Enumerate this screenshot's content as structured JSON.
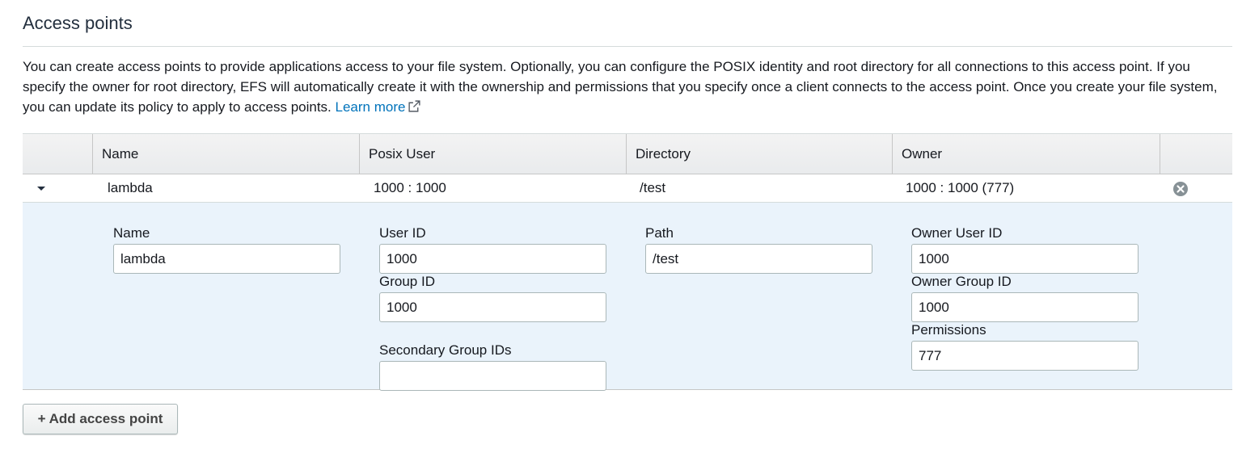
{
  "section": {
    "title": "Access points",
    "description": "You can create access points to provide applications access to your file system. Optionally, you can configure the POSIX identity and root directory for all connections to this access point. If you specify the owner for root directory, EFS will automatically create it with the ownership and permissions that you specify once a client connects to the access point. Once you create your file system, you can update its policy to apply to access points.",
    "learn_more": "Learn more"
  },
  "table": {
    "headers": [
      "",
      "Name",
      "Posix User",
      "Directory",
      "Owner",
      ""
    ],
    "rows": [
      {
        "name": "lambda",
        "posix_user": "1000 : 1000",
        "directory": "/test",
        "owner": "1000 : 1000 (777)"
      }
    ]
  },
  "detail": {
    "name_label": "Name",
    "name_value": "lambda",
    "user_id_label": "User ID",
    "user_id_value": "1000",
    "group_id_label": "Group ID",
    "group_id_value": "1000",
    "secondary_group_ids_label": "Secondary Group IDs",
    "secondary_group_ids_value": "",
    "path_label": "Path",
    "path_value": "/test",
    "owner_user_id_label": "Owner User ID",
    "owner_user_id_value": "1000",
    "owner_group_id_label": "Owner Group ID",
    "owner_group_id_value": "1000",
    "permissions_label": "Permissions",
    "permissions_value": "777"
  },
  "actions": {
    "add_access_point": "+ Add access point"
  },
  "icons": {
    "expand": "caret-down-icon",
    "remove": "remove-circle-icon",
    "external_link": "external-link-icon"
  },
  "colors": {
    "link": "#0073bb",
    "detail_background": "#eaf3fb"
  }
}
